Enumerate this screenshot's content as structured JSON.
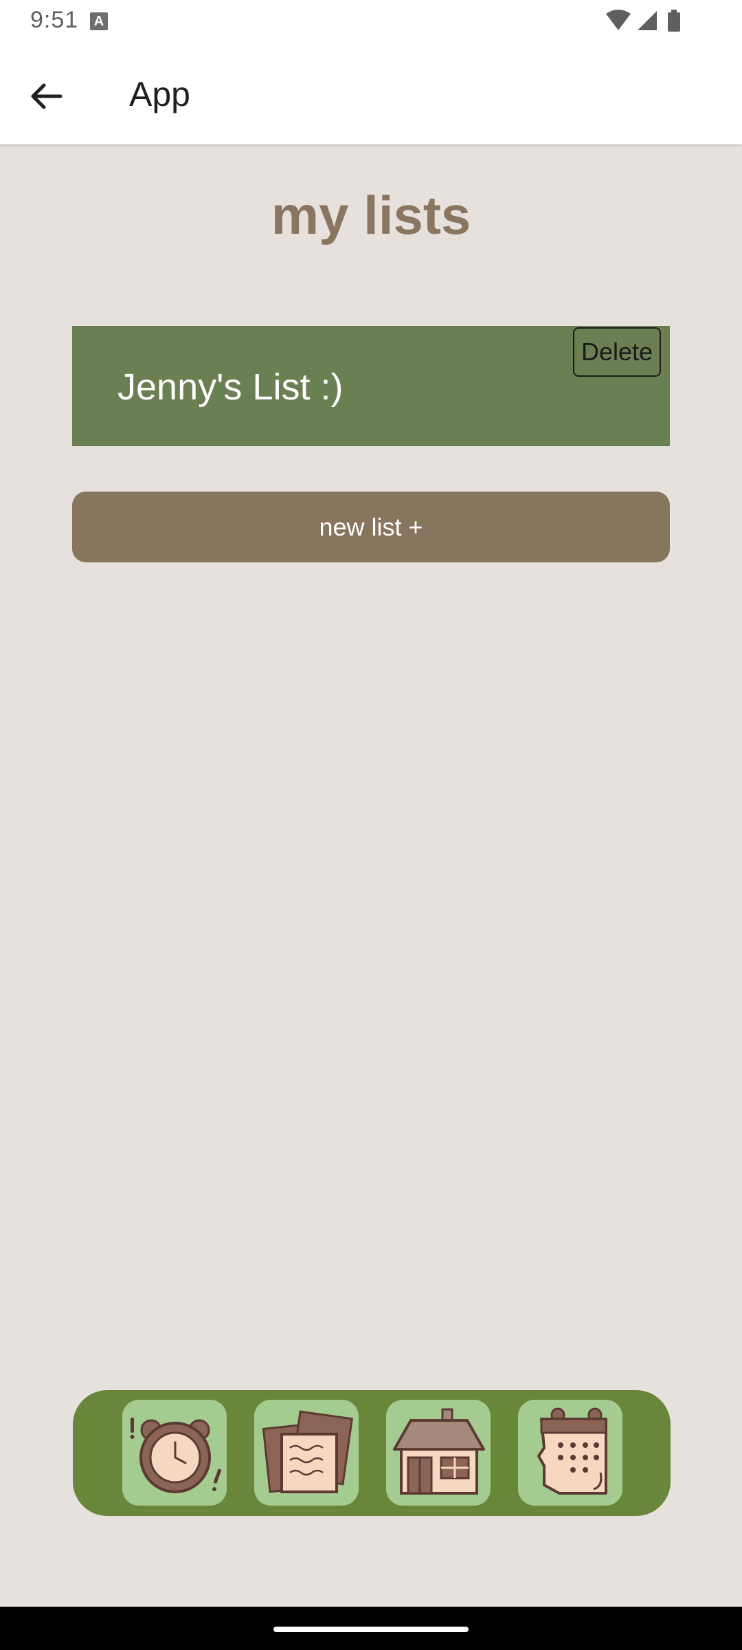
{
  "status_bar": {
    "time": "9:51",
    "icons": [
      "a-notification-icon",
      "wifi-icon",
      "signal-icon",
      "battery-icon"
    ]
  },
  "app_bar": {
    "title": "App",
    "back_icon": "arrow-left-icon"
  },
  "page": {
    "title": "my lists"
  },
  "lists": [
    {
      "name": "Jenny's List :)",
      "delete_label": "Delete"
    }
  ],
  "new_list_label": "new list +",
  "bottom_nav": {
    "items": [
      {
        "icon": "alarm-clock-icon"
      },
      {
        "icon": "notes-icon"
      },
      {
        "icon": "house-icon"
      },
      {
        "icon": "calendar-icon"
      }
    ]
  },
  "colors": {
    "background": "#e6e1dc",
    "list_card": "#6a7f52",
    "new_list_button": "#88755d",
    "nav_background": "#6a863b",
    "nav_tile": "#a4cb90",
    "title_text": "#8a7560"
  }
}
